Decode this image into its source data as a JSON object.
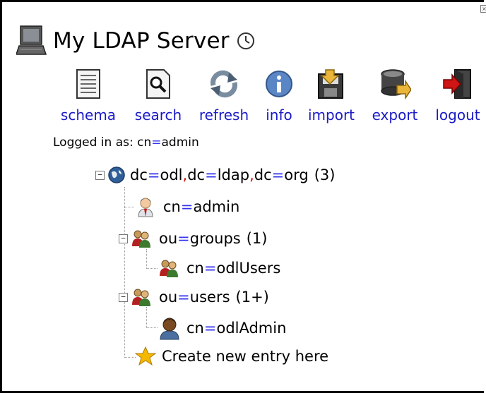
{
  "server": {
    "title": "My LDAP Server"
  },
  "toolbar": {
    "items": [
      {
        "label": "schema",
        "icon": "schema-icon"
      },
      {
        "label": "search",
        "icon": "search-icon"
      },
      {
        "label": "refresh",
        "icon": "refresh-icon"
      },
      {
        "label": "info",
        "icon": "info-icon"
      },
      {
        "label": "import",
        "icon": "import-icon"
      },
      {
        "label": "export",
        "icon": "export-icon"
      },
      {
        "label": "logout",
        "icon": "logout-icon"
      }
    ]
  },
  "login": {
    "prefix": "Logged in as: ",
    "user_attr": "cn",
    "user_val": "admin"
  },
  "tree": {
    "root": {
      "parts": [
        [
          "dc",
          "odl"
        ],
        [
          "dc",
          "ldap"
        ],
        [
          "dc",
          "org"
        ]
      ],
      "count": "(3)"
    },
    "admin": {
      "attr": "cn",
      "val": "admin"
    },
    "groups": {
      "attr": "ou",
      "val": "groups",
      "count": "(1)"
    },
    "odlUsers": {
      "attr": "cn",
      "val": "odlUsers"
    },
    "users": {
      "attr": "ou",
      "val": "users",
      "count": "(1+)"
    },
    "odlAdmin": {
      "attr": "cn",
      "val": "odlAdmin"
    },
    "create": {
      "label": "Create new entry here"
    }
  },
  "colors": {
    "link": "#1a1ac8",
    "equals": "#3333ee",
    "comma": "#d01010"
  }
}
